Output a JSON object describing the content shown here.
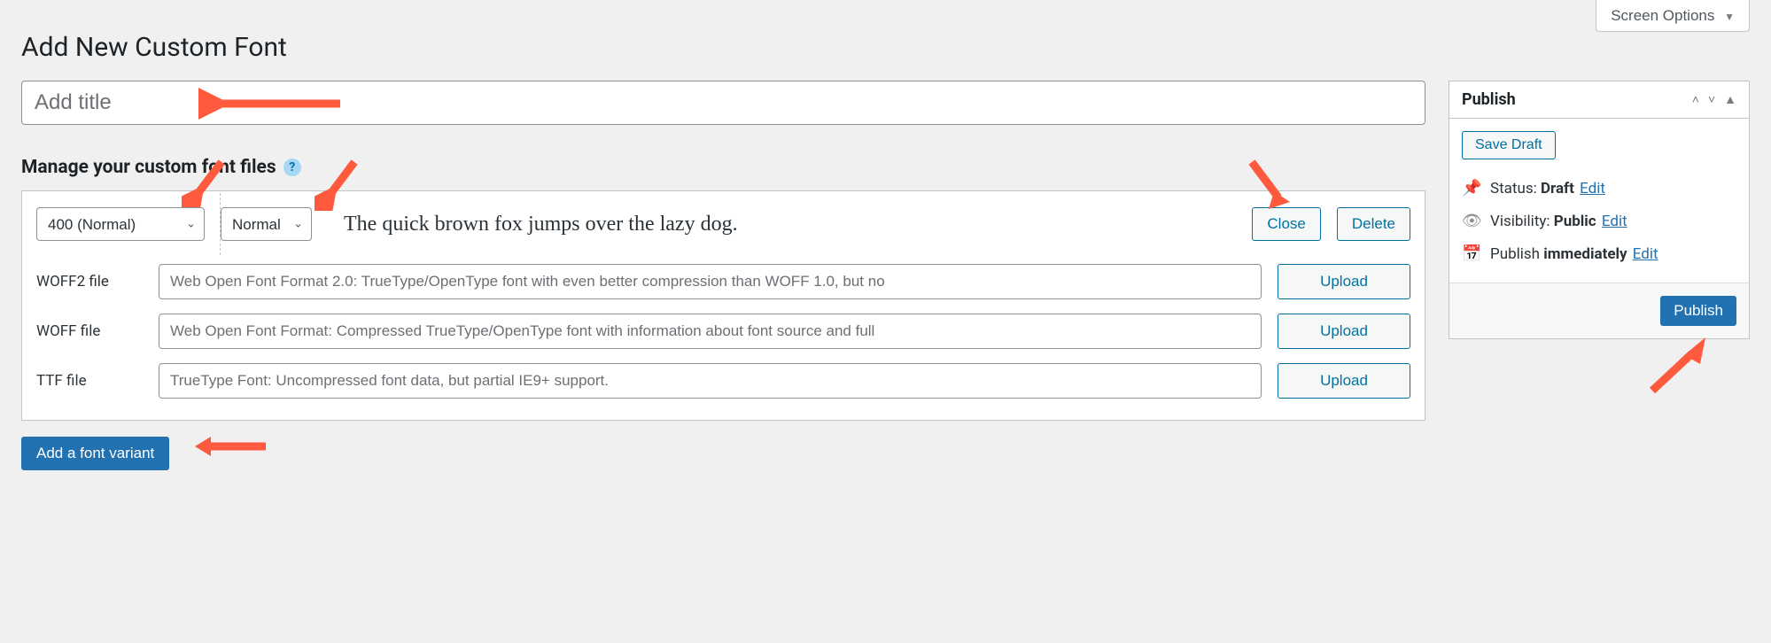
{
  "screen_options_label": "Screen Options",
  "page_title": "Add New Custom Font",
  "title_placeholder": "Add title",
  "manage_heading": "Manage your custom font files",
  "variant": {
    "weight_selected": "400 (Normal)",
    "style_selected": "Normal",
    "preview_text": "The quick brown fox jumps over the lazy dog.",
    "close_label": "Close",
    "delete_label": "Delete"
  },
  "file_rows": [
    {
      "label": "WOFF2 file",
      "placeholder": "Web Open Font Format 2.0: TrueType/OpenType font with even better compression than WOFF 1.0, but no",
      "upload": "Upload"
    },
    {
      "label": "WOFF file",
      "placeholder": "Web Open Font Format: Compressed TrueType/OpenType font with information about font source and full",
      "upload": "Upload"
    },
    {
      "label": "TTF file",
      "placeholder": "TrueType Font: Uncompressed font data, but partial IE9+ support.",
      "upload": "Upload"
    }
  ],
  "add_variant_label": "Add a font variant",
  "publish_box": {
    "title": "Publish",
    "save_draft": "Save Draft",
    "status_label": "Status:",
    "status_value": "Draft",
    "visibility_label": "Visibility:",
    "visibility_value": "Public",
    "publish_label": "Publish",
    "publish_value": "immediately",
    "edit": "Edit",
    "publish_button": "Publish"
  }
}
